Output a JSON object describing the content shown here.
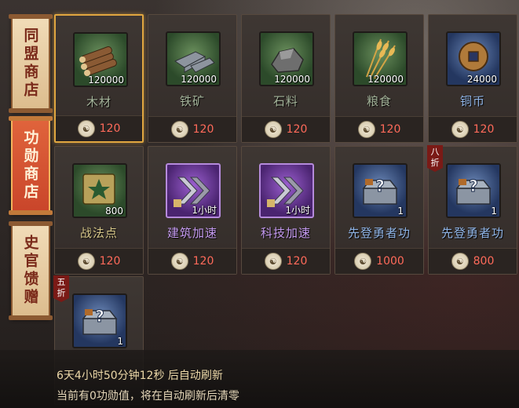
{
  "tabs": [
    {
      "label": "同盟商店",
      "active": false
    },
    {
      "label": "功勋商店",
      "active": true
    },
    {
      "label": "史官馈赠",
      "active": false
    }
  ],
  "items": [
    {
      "name": "木材",
      "qty": "120000",
      "price": "120",
      "icon": "wood-icon",
      "frame": "green",
      "name_color": "green"
    },
    {
      "name": "铁矿",
      "qty": "120000",
      "price": "120",
      "icon": "iron-ore-icon",
      "frame": "green",
      "name_color": "green"
    },
    {
      "name": "石料",
      "qty": "120000",
      "price": "120",
      "icon": "stone-icon",
      "frame": "green",
      "name_color": "green"
    },
    {
      "name": "粮食",
      "qty": "120000",
      "price": "120",
      "icon": "grain-icon",
      "frame": "green",
      "name_color": "green"
    },
    {
      "name": "铜币",
      "qty": "24000",
      "price": "120",
      "icon": "copper-coin-icon",
      "frame": "blue",
      "name_color": "blue"
    },
    {
      "name": "战法点",
      "qty": "800",
      "price": "120",
      "icon": "tactic-point-icon",
      "frame": "green",
      "name_color": "yellow"
    },
    {
      "name": "建筑加速",
      "qty": "1小时",
      "price": "120",
      "icon": "building-speedup-icon",
      "frame": "purple",
      "name_color": "purple"
    },
    {
      "name": "科技加速",
      "qty": "1小时",
      "price": "120",
      "icon": "tech-speedup-icon",
      "frame": "purple",
      "name_color": "purple"
    },
    {
      "name": "先登勇者功",
      "qty": "1",
      "price": "1000",
      "icon": "mystery-chest-icon",
      "frame": "blue",
      "name_color": "blue"
    },
    {
      "name": "先登勇者功",
      "qty": "1",
      "price": "800",
      "icon": "mystery-chest-icon",
      "frame": "blue",
      "name_color": "blue",
      "discount": "八折"
    },
    {
      "name": "",
      "qty": "1",
      "price": "",
      "icon": "mystery-chest-icon",
      "frame": "blue",
      "name_color": "blue",
      "discount": "五折"
    }
  ],
  "footer": {
    "refresh_text": "6天4小时50分钟12秒 后自动刷新",
    "merit_text": "当前有0功勋值，将在自动刷新后清零"
  },
  "currency_icon": "merit-coin-icon",
  "colors": {
    "price": "#ff6a5a",
    "active_tab": "#d4552f",
    "selected_border": "#e0a640"
  }
}
